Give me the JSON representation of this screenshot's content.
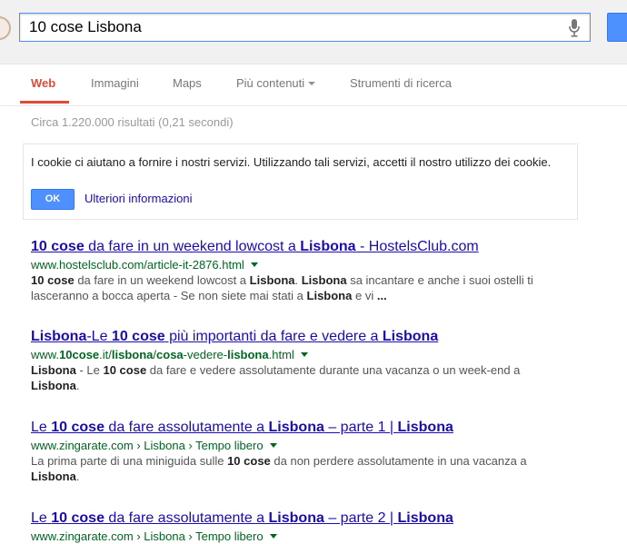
{
  "search": {
    "query": "10 cose Lisbona"
  },
  "tabs": [
    {
      "label": "Web",
      "active": true
    },
    {
      "label": "Immagini"
    },
    {
      "label": "Maps"
    },
    {
      "label": "Più contenuti",
      "dropdown": true
    },
    {
      "label": "Strumenti di ricerca"
    }
  ],
  "stats": "Circa 1.220.000 risultati (0,21 secondi)",
  "cookie_notice": {
    "text": "I cookie ci aiutano a fornire i nostri servizi. Utilizzando tali servizi, accetti il nostro utilizzo dei cookie.",
    "ok_label": "OK",
    "more_label": "Ulteriori informazioni"
  },
  "results": [
    {
      "title": [
        {
          "t": "10 cose",
          "b": true
        },
        {
          "t": " da fare in un weekend lowcost a "
        },
        {
          "t": "Lisbona",
          "b": true
        },
        {
          "t": " - HostelsClub.com"
        }
      ],
      "url": [
        {
          "t": "www.hostelsclub.com/article-it-2876.html"
        }
      ],
      "snippet": [
        {
          "t": "10 cose",
          "b": true
        },
        {
          "t": " da fare in un weekend lowcost a "
        },
        {
          "t": "Lisbona",
          "b": true
        },
        {
          "t": ". "
        },
        {
          "t": "Lisbona",
          "b": true
        },
        {
          "t": " sa incantare e anche i suoi ostelli ti lasceranno a bocca aperta - Se non siete mai stati a "
        },
        {
          "t": "Lisbona",
          "b": true
        },
        {
          "t": " e vi "
        },
        {
          "t": "...",
          "b": true
        }
      ]
    },
    {
      "title": [
        {
          "t": "Lisbona",
          "b": true
        },
        {
          "t": "-Le "
        },
        {
          "t": "10 cose",
          "b": true
        },
        {
          "t": " più importanti da fare e vedere a "
        },
        {
          "t": "Lisbona",
          "b": true
        }
      ],
      "url": [
        {
          "t": "www."
        },
        {
          "t": "10cose",
          "b": true
        },
        {
          "t": ".it/"
        },
        {
          "t": "lisbona",
          "b": true
        },
        {
          "t": "/"
        },
        {
          "t": "cosa",
          "b": true
        },
        {
          "t": "-vedere-"
        },
        {
          "t": "lisbona",
          "b": true
        },
        {
          "t": ".html"
        }
      ],
      "snippet": [
        {
          "t": "Lisbona",
          "b": true
        },
        {
          "t": " - Le "
        },
        {
          "t": "10 cose",
          "b": true
        },
        {
          "t": " da fare e vedere assolutamente durante una vacanza o un week-end a "
        },
        {
          "t": "Lisbona",
          "b": true
        },
        {
          "t": "."
        }
      ]
    },
    {
      "title": [
        {
          "t": "Le "
        },
        {
          "t": "10 cose",
          "b": true
        },
        {
          "t": " da fare assolutamente a "
        },
        {
          "t": "Lisbona",
          "b": true
        },
        {
          "t": " – parte 1 | "
        },
        {
          "t": "Lisbona",
          "b": true
        }
      ],
      "url": [
        {
          "t": "www.zingarate.com › Lisbona › Tempo libero"
        }
      ],
      "snippet": [
        {
          "t": "La prima parte di una miniguida sulle "
        },
        {
          "t": "10 cose",
          "b": true
        },
        {
          "t": " da non perdere assolutamente in una vacanza a "
        },
        {
          "t": "Lisbona",
          "b": true
        },
        {
          "t": "."
        }
      ]
    },
    {
      "title": [
        {
          "t": "Le "
        },
        {
          "t": "10 cose",
          "b": true
        },
        {
          "t": " da fare assolutamente a "
        },
        {
          "t": "Lisbona",
          "b": true
        },
        {
          "t": " – parte 2 | "
        },
        {
          "t": "Lisbona",
          "b": true
        }
      ],
      "url": [
        {
          "t": "www.zingarate.com › Lisbona › Tempo libero"
        }
      ],
      "snippet": []
    }
  ]
}
